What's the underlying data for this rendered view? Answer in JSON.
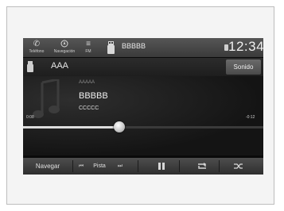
{
  "status_bar": {
    "phone_label": "Teléfono",
    "nav_label": "Navegación",
    "fm_label": "FM",
    "source_title": "BBBBB",
    "clock": "12:34"
  },
  "header": {
    "album": "AAA",
    "sound_button": "Sonido"
  },
  "now_playing": {
    "line1": "AAAAA",
    "title": "BBBBB",
    "line3": "CCCCC",
    "elapsed": "0:08",
    "remaining": "-0:12",
    "progress_fraction": 0.4
  },
  "controls": {
    "navegar": "Navegar",
    "prev_icon": "skip-back-icon",
    "pista": "Pista",
    "next_icon": "skip-forward-icon",
    "pause_icon": "pause-icon",
    "repeat_icon": "repeat-icon",
    "shuffle_icon": "shuffle-icon"
  }
}
